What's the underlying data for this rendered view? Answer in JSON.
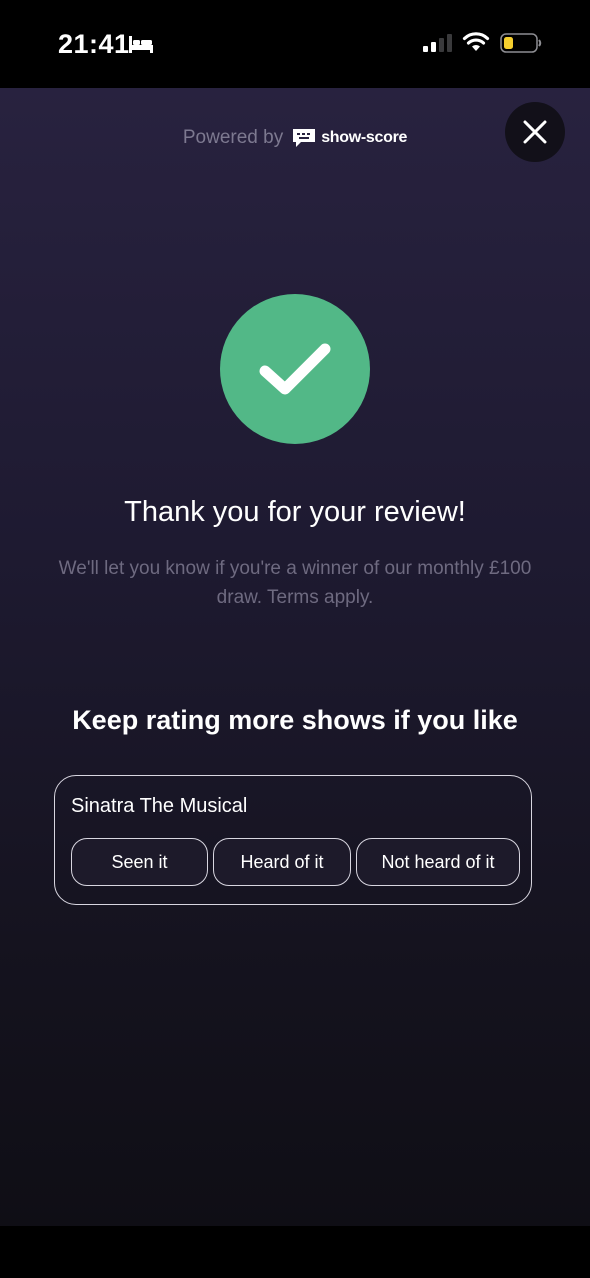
{
  "status_bar": {
    "time": "21:41",
    "colors": {
      "battery_fill": "#f5cf2e"
    }
  },
  "header": {
    "powered_by": "Powered by",
    "brand_name": "show-score"
  },
  "success": {
    "color": "#52b887"
  },
  "thanks": {
    "title": "Thank you for your review!",
    "message": "We'll let you know if you're a winner of our monthly £100 draw. Terms apply."
  },
  "keep_rating": {
    "title": "Keep rating more shows if you like"
  },
  "show": {
    "name": "Sinatra The Musical",
    "options": [
      "Seen it",
      "Heard of it",
      "Not heard of it"
    ]
  }
}
